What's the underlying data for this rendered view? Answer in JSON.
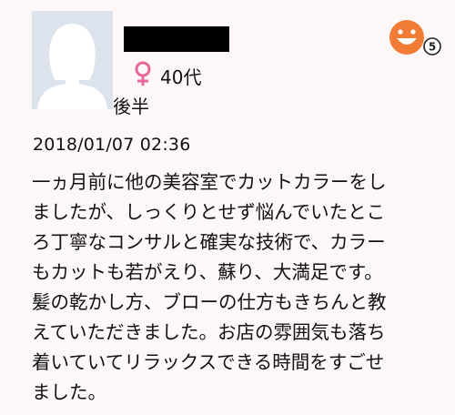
{
  "reviewer": {
    "avatar_icon": "default-female-avatar-icon",
    "gender_icon": "female-symbol-icon",
    "gender_color": "#e8679a",
    "age_label": "40代",
    "age_suffix": "後半"
  },
  "rating": {
    "icon": "smiley-face-icon",
    "face_color": "#f07c36",
    "value": "5"
  },
  "review": {
    "date": "2018/01/07 02:36",
    "lines": [
      "一ヵ月前に他の美容室でカットカラーをし",
      "ましたが、しっくりとせず悩んでいたとこ",
      "ろ丁寧なコンサルと確実な技術で、カラー",
      "もカットも若がえり、蘇り、大満足です。",
      "髪の乾かし方、ブローの仕方もきちんと教",
      "えていただきました。お店の雰囲気も落ち",
      "着いていてリラックスできる時間をすごせ",
      "ました。"
    ]
  }
}
